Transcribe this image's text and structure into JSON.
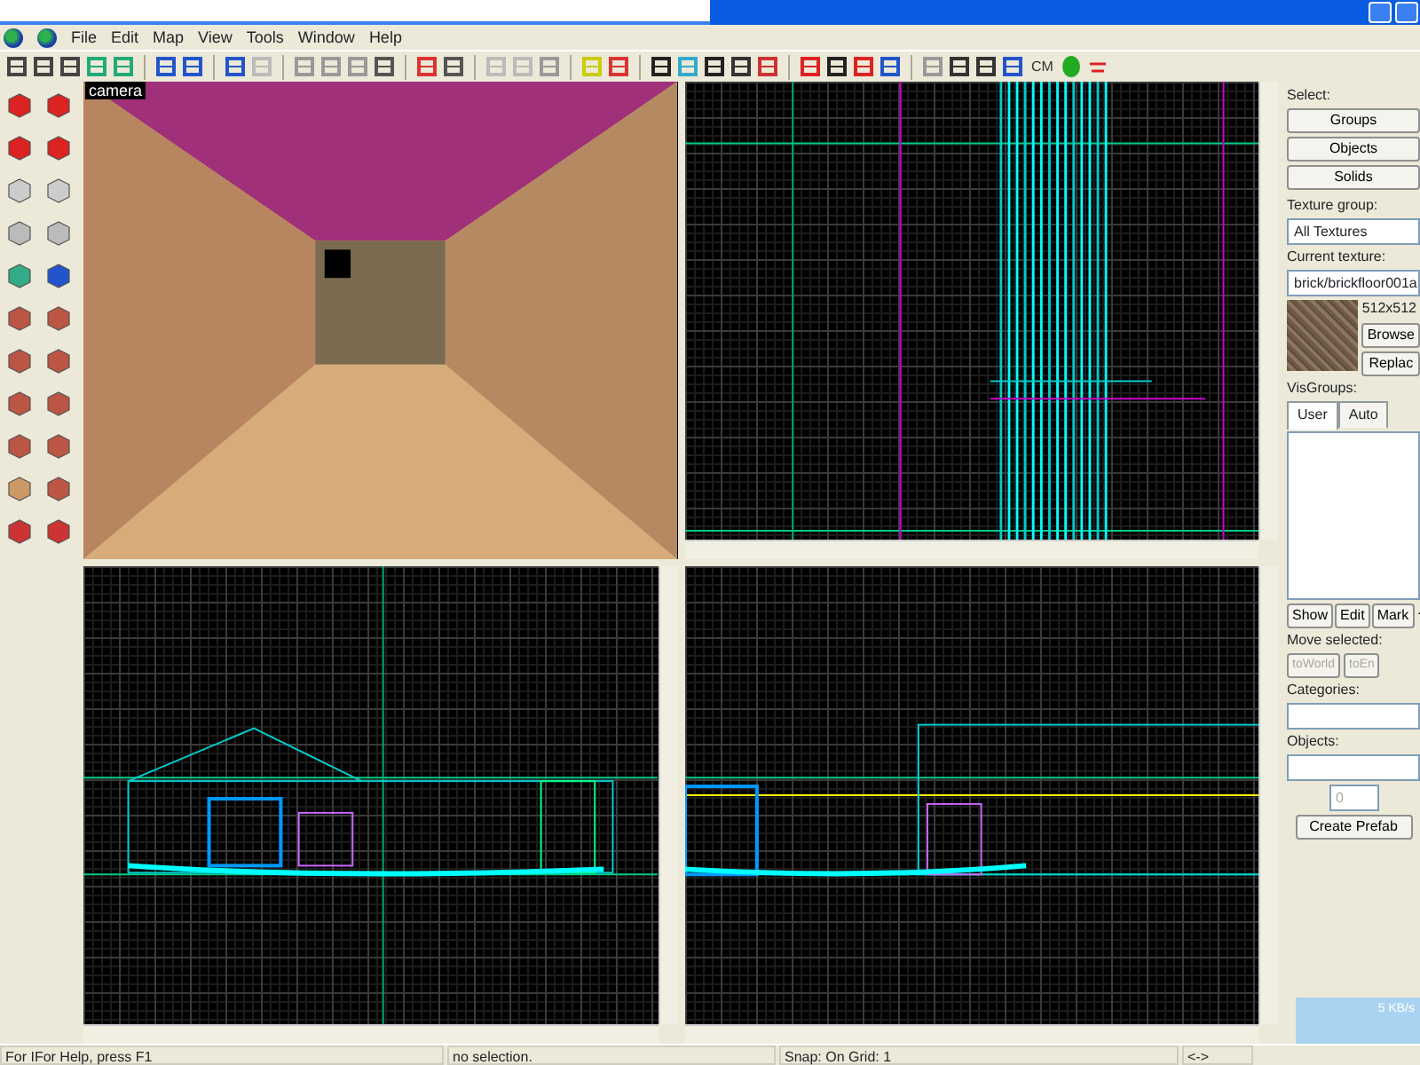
{
  "menu": [
    "File",
    "Edit",
    "Map",
    "View",
    "Tools",
    "Window",
    "Help"
  ],
  "toolbar": {
    "text_buttons": [
      "CM"
    ]
  },
  "viewports": [
    {
      "kind": "camera",
      "label": "camera"
    },
    {
      "kind": "top"
    },
    {
      "kind": "front"
    },
    {
      "kind": "side"
    }
  ],
  "side_panel": {
    "select_label": "Select:",
    "select_buttons": [
      "Groups",
      "Objects",
      "Solids"
    ],
    "texture_group_label": "Texture group:",
    "texture_group": "All Textures",
    "current_texture_label": "Current texture:",
    "current_texture": "brick/brickfloor001a",
    "texture_size": "512x512",
    "texture_buttons": [
      "Browse",
      "Replac"
    ],
    "visgroups_label": "VisGroups:",
    "visgroup_tabs": [
      {
        "label": "User",
        "selected": true
      },
      {
        "label": "Auto",
        "selected": false
      }
    ],
    "visgroup_buttons": [
      "Show",
      "Edit",
      "Mark"
    ],
    "move_label": "Move selected:",
    "move_buttons": [
      {
        "label": "toWorld",
        "disabled": true
      },
      {
        "label": "toEn",
        "disabled": true
      }
    ],
    "categories_label": "Categories:",
    "objects_label": "Objects:",
    "count": {
      "value": "0",
      "disabled": true
    },
    "create_button": "Create Prefab"
  },
  "tray_overlay": "5 KB/s",
  "status_bar": [
    "For IFor Help, press F1",
    "no selection.",
    "Snap: On Grid: 1",
    "<->"
  ]
}
